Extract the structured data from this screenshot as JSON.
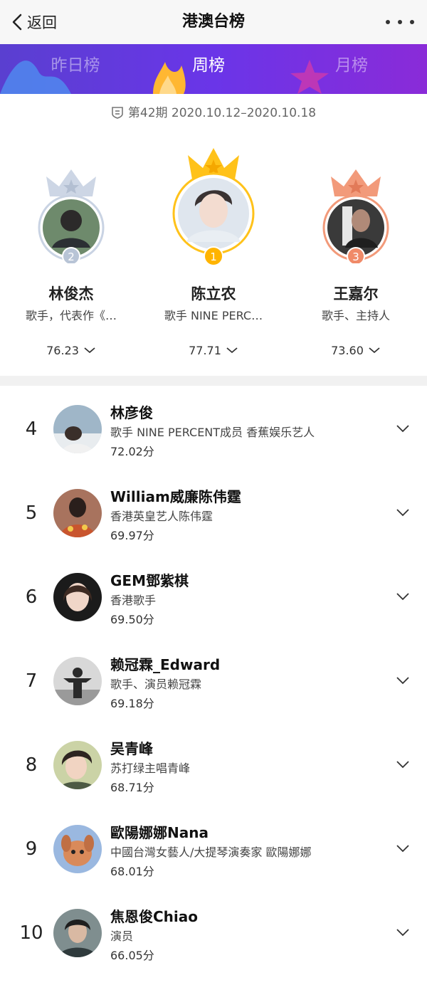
{
  "header": {
    "back_label": "返回",
    "title": "港澳台榜"
  },
  "tabs": [
    {
      "label": "昨日榜",
      "active": false
    },
    {
      "label": "周榜",
      "active": true
    },
    {
      "label": "月榜",
      "active": false
    }
  ],
  "period": {
    "text": "第42期 2020.10.12–2020.10.18"
  },
  "podium": [
    {
      "rank": "2",
      "name": "林俊杰",
      "desc": "歌手，代表作《…",
      "score": "76.23",
      "crown_color": "#c9d3e3",
      "badge_color": "#b8c4d6"
    },
    {
      "rank": "1",
      "name": "陈立农",
      "desc": "歌手 NINE PERC…",
      "score": "77.71",
      "crown_color": "#ffc21a",
      "badge_color": "#ffb400"
    },
    {
      "rank": "3",
      "name": "王嘉尔",
      "desc": "歌手、主持人",
      "score": "73.60",
      "crown_color": "#f29a7a",
      "badge_color": "#f08a68"
    }
  ],
  "list": [
    {
      "rank": "4",
      "name": "林彦俊",
      "desc": "歌手 NINE PERCENT成员 香蕉娱乐艺人",
      "score": "72.02分"
    },
    {
      "rank": "5",
      "name": "William威廉陈伟霆",
      "desc": "香港英皇艺人陈伟霆",
      "score": "69.97分"
    },
    {
      "rank": "6",
      "name": "GEM鄧紫棋",
      "desc": "香港歌手",
      "score": "69.50分"
    },
    {
      "rank": "7",
      "name": "赖冠霖_Edward",
      "desc": "歌手、演员赖冠霖",
      "score": "69.18分"
    },
    {
      "rank": "8",
      "name": "吴青峰",
      "desc": "苏打绿主唱青峰",
      "score": "68.71分"
    },
    {
      "rank": "9",
      "name": "歐陽娜娜Nana",
      "desc": "中國台灣女藝人/大提琴演奏家 歐陽娜娜",
      "score": "68.01分"
    },
    {
      "rank": "10",
      "name": "焦恩俊Chiao",
      "desc": "演员",
      "score": "66.05分"
    }
  ],
  "colors": {
    "tab_bar_start": "#5a3fd0",
    "tab_bar_end": "#8a2bd8"
  }
}
